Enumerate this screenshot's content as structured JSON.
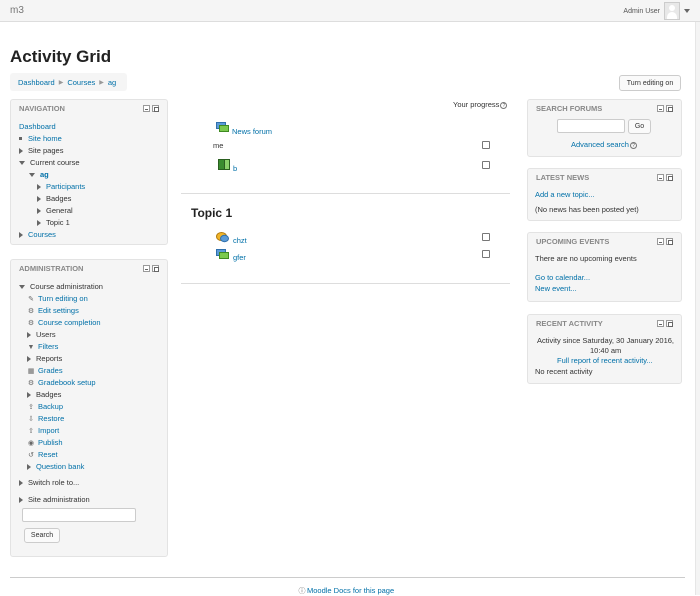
{
  "header": {
    "site_name": "m3",
    "user_name": "Admin User"
  },
  "page": {
    "title": "Activity Grid",
    "breadcrumb": [
      "Dashboard",
      "Courses",
      "ag"
    ],
    "edit_button": "Turn editing on"
  },
  "navigation": {
    "title": "NAVIGATION",
    "items": [
      "Dashboard",
      "Site home",
      "Site pages",
      "Current course",
      "ag",
      "Participants",
      "Badges",
      "General",
      "Topic 1",
      "Courses"
    ]
  },
  "administration": {
    "title": "ADMINISTRATION",
    "items": [
      "Course administration",
      "Turn editing on",
      "Edit settings",
      "Course completion",
      "Users",
      "Filters",
      "Reports",
      "Grades",
      "Gradebook setup",
      "Badges",
      "Backup",
      "Restore",
      "Import",
      "Publish",
      "Reset",
      "Question bank",
      "Switch role to...",
      "Site administration"
    ],
    "search_button": "Search"
  },
  "main": {
    "progress_label": "Your progress",
    "section0": [
      {
        "name": "News forum",
        "icon": "forum-icon"
      },
      {
        "name": "me",
        "icon": "none"
      },
      {
        "name": "b",
        "icon": "book-icon"
      }
    ],
    "topic_title": "Topic 1",
    "topic_items": [
      {
        "name": "chzt",
        "icon": "chat-icon"
      },
      {
        "name": "gfer",
        "icon": "forum-icon"
      }
    ]
  },
  "search_forums": {
    "title": "SEARCH FORUMS",
    "go_button": "Go",
    "advanced_link": "Advanced search"
  },
  "latest_news": {
    "title": "LATEST NEWS",
    "add_link": "Add a new topic...",
    "empty_text": "(No news has been posted yet)"
  },
  "upcoming_events": {
    "title": "UPCOMING EVENTS",
    "empty_text": "There are no upcoming events",
    "calendar_link": "Go to calendar...",
    "new_event_link": "New event..."
  },
  "recent_activity": {
    "title": "RECENT ACTIVITY",
    "since_line1": "Activity since Saturday, 30 January 2016,",
    "since_line2": "10:40 am",
    "report_link": "Full report of recent activity...",
    "empty_text": "No recent activity"
  },
  "footer": {
    "docs_link": "Moodle Docs for this page"
  },
  "colors": {
    "link": "#0070a8",
    "block_bg": "#f5f5f5",
    "block_title": "#888888"
  }
}
